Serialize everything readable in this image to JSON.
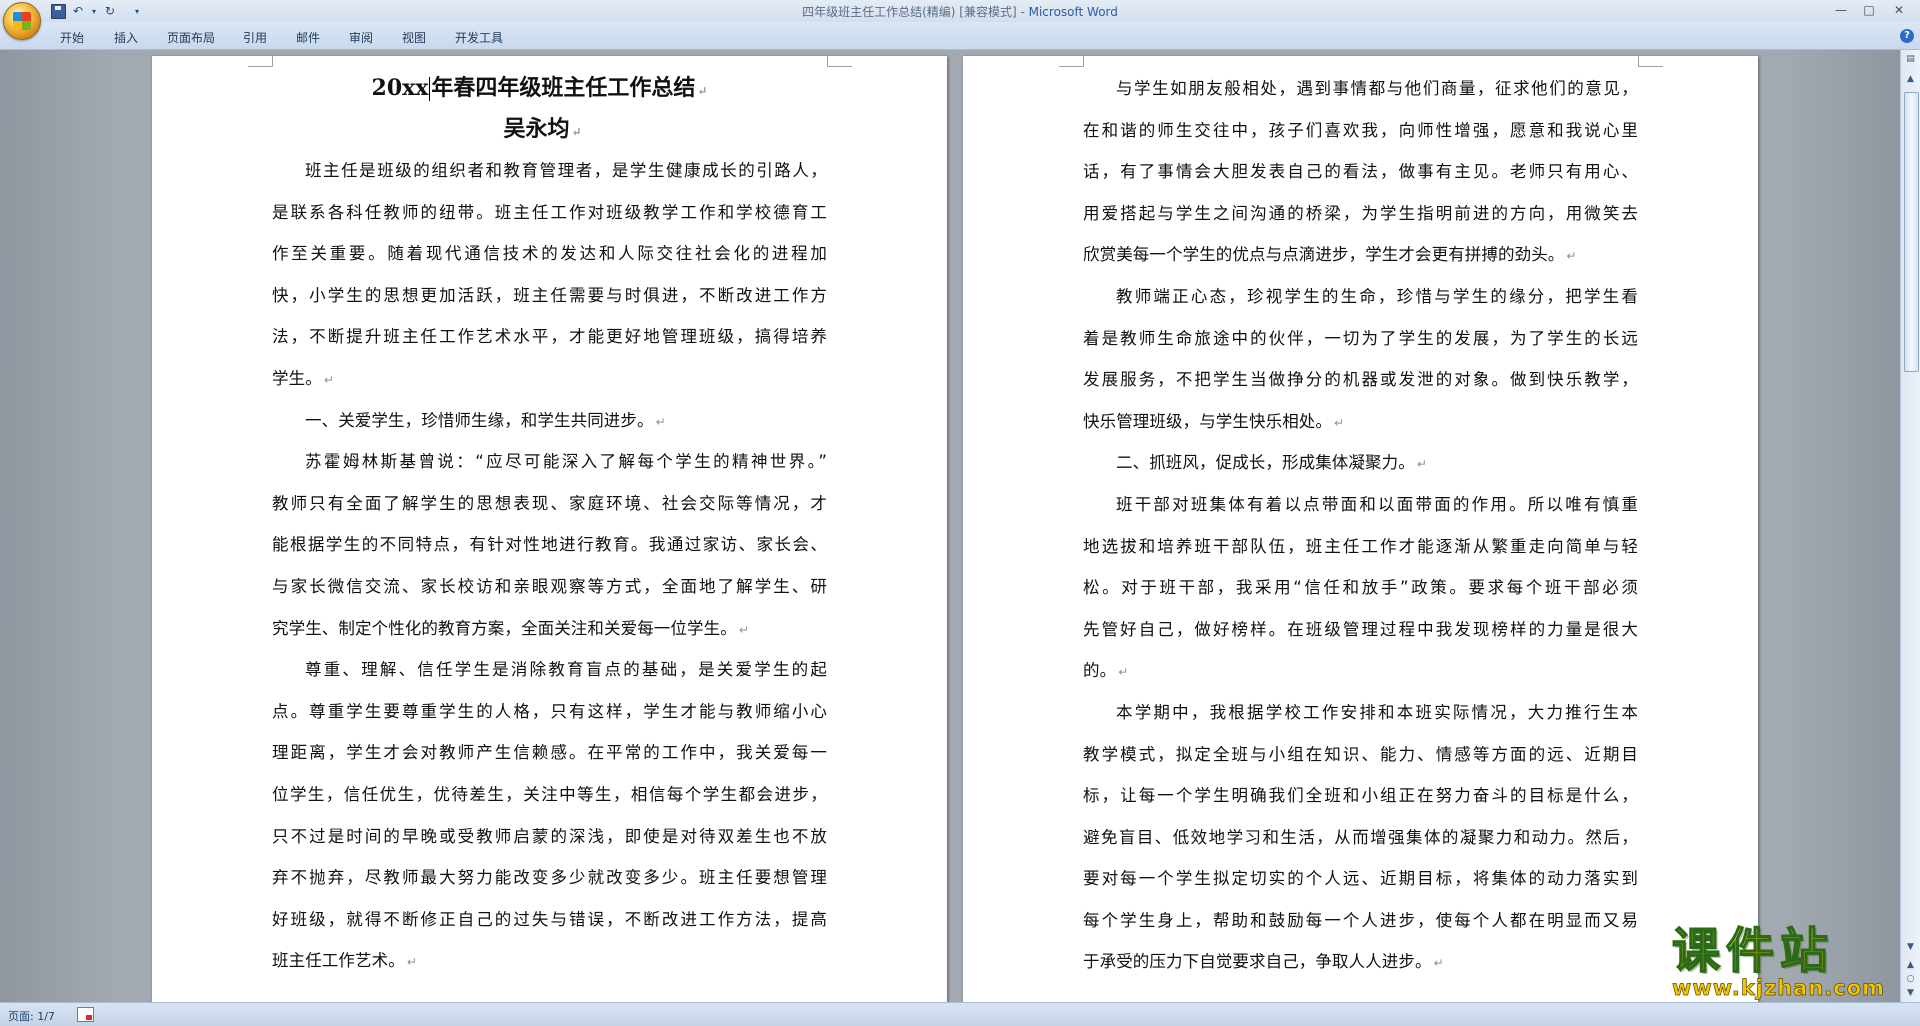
{
  "window": {
    "title": "四年级班主任工作总结(精编) [兼容模式] - ",
    "app_name": "Microsoft Word",
    "controls": [
      "—",
      "□",
      "✕"
    ]
  },
  "qat": {
    "undo": "↶",
    "redo": "↻",
    "customize": "▾"
  },
  "ribbon": {
    "tabs": [
      "开始",
      "插入",
      "页面布局",
      "引用",
      "邮件",
      "审阅",
      "视图",
      "开发工具"
    ],
    "help": "?"
  },
  "document": {
    "title_pre": "20xx",
    "title_post": "年春四年级班主任工作总结",
    "author": "吴永均",
    "paragraph_mark": "↵",
    "left_page_lines": [
      {
        "text": "班主任是班级的组织者和教育管理者，是学生健康成长的引路人，",
        "indent": true,
        "last": false
      },
      {
        "text": "是联系各科任教师的纽带。班主任工作对班级教学工作和学校德育工",
        "indent": false,
        "last": false
      },
      {
        "text": "作至关重要。随着现代通信技术的发达和人际交往社会化的进程加",
        "indent": false,
        "last": false
      },
      {
        "text": "快，小学生的思想更加活跃，班主任需要与时俱进，不断改进工作方",
        "indent": false,
        "last": false
      },
      {
        "text": "法，不断提升班主任工作艺术水平，才能更好地管理班级，搞得培养",
        "indent": false,
        "last": false
      },
      {
        "text": "学生。",
        "indent": false,
        "last": true
      },
      {
        "text": "一、关爱学生，珍惜师生缘，和学生共同进步。",
        "indent": true,
        "last": true
      },
      {
        "text": "苏霍姆林斯基曾说：“应尽可能深入了解每个学生的精神世界。”",
        "indent": true,
        "last": false
      },
      {
        "text": "教师只有全面了解学生的思想表现、家庭环境、社会交际等情况，才",
        "indent": false,
        "last": false
      },
      {
        "text": "能根据学生的不同特点，有针对性地进行教育。我通过家访、家长会、",
        "indent": false,
        "last": false
      },
      {
        "text": "与家长微信交流、家长校访和亲眼观察等方式，全面地了解学生、研",
        "indent": false,
        "last": false
      },
      {
        "text": "究学生、制定个性化的教育方案，全面关注和关爱每一位学生。",
        "indent": false,
        "last": true
      },
      {
        "text": "尊重、理解、信任学生是消除教育盲点的基础，是关爱学生的起",
        "indent": true,
        "last": false
      },
      {
        "text": "点。尊重学生要尊重学生的人格，只有这样，学生才能与教师缩小心",
        "indent": false,
        "last": false
      },
      {
        "text": "理距离，学生才会对教师产生信赖感。在平常的工作中，我关爱每一",
        "indent": false,
        "last": false
      },
      {
        "text": "位学生，信任优生，优待差生，关注中等生，相信每个学生都会进步，",
        "indent": false,
        "last": false
      },
      {
        "text": "只不过是时间的早晚或受教师启蒙的深浅，即使是对待双差生也不放",
        "indent": false,
        "last": false
      },
      {
        "text": "弃不抛弃，尽教师最大努力能改变多少就改变多少。班主任要想管理",
        "indent": false,
        "last": false
      },
      {
        "text": "好班级，就得不断修正自己的过失与错误，不断改进工作方法，提高",
        "indent": false,
        "last": false
      },
      {
        "text": "班主任工作艺术。",
        "indent": false,
        "last": true
      }
    ],
    "right_page_lines": [
      {
        "text": "与学生如朋友般相处，遇到事情都与他们商量，征求他们的意见，",
        "indent": true,
        "last": false
      },
      {
        "text": "在和谐的师生交往中，孩子们喜欢我，向师性增强，愿意和我说心里",
        "indent": false,
        "last": false
      },
      {
        "text": "话，有了事情会大胆发表自己的看法，做事有主见。老师只有用心、",
        "indent": false,
        "last": false
      },
      {
        "text": "用爱搭起与学生之间沟通的桥梁，为学生指明前进的方向，用微笑去",
        "indent": false,
        "last": false
      },
      {
        "text": "欣赏美每一个学生的优点与点滴进步，学生才会更有拼搏的劲头。",
        "indent": false,
        "last": true
      },
      {
        "text": "教师端正心态，珍视学生的生命，珍惜与学生的缘分，把学生看",
        "indent": true,
        "last": false
      },
      {
        "text": "着是教师生命旅途中的伙伴，一切为了学生的发展，为了学生的长远",
        "indent": false,
        "last": false
      },
      {
        "text": "发展服务，不把学生当做挣分的机器或发泄的对象。做到快乐教学，",
        "indent": false,
        "last": false
      },
      {
        "text": "快乐管理班级，与学生快乐相处。",
        "indent": false,
        "last": true
      },
      {
        "text": "二、抓班风，促成长，形成集体凝聚力。",
        "indent": true,
        "last": true
      },
      {
        "text": "班干部对班集体有着以点带面和以面带面的作用。所以唯有慎重",
        "indent": true,
        "last": false
      },
      {
        "text": "地选拔和培养班干部队伍，班主任工作才能逐渐从繁重走向简单与轻",
        "indent": false,
        "last": false
      },
      {
        "text": "松。对于班干部，我采用“信任和放手”政策。要求每个班干部必须",
        "indent": false,
        "last": false
      },
      {
        "text": "先管好自己，做好榜样。在班级管理过程中我发现榜样的力量是很大",
        "indent": false,
        "last": false
      },
      {
        "text": "的。",
        "indent": false,
        "last": true
      },
      {
        "text": "本学期中，我根据学校工作安排和本班实际情况，大力推行生本",
        "indent": true,
        "last": false
      },
      {
        "text": "教学模式，拟定全班与小组在知识、能力、情感等方面的远、近期目",
        "indent": false,
        "last": false
      },
      {
        "text": "标，让每一个学生明确我们全班和小组正在努力奋斗的目标是什么，",
        "indent": false,
        "last": false
      },
      {
        "text": "避免盲目、低效地学习和生活，从而增强集体的凝聚力和动力。然后，",
        "indent": false,
        "last": false
      },
      {
        "text": "要对每一个学生拟定切实的个人远、近期目标，将集体的动力落实到",
        "indent": false,
        "last": false
      },
      {
        "text": "每个学生身上，帮助和鼓励每一个人进步，使每个人都在明显而又易",
        "indent": false,
        "last": false
      },
      {
        "text": "于承受的压力下自觉要求自己，争取人人进步。",
        "indent": false,
        "last": true
      }
    ]
  },
  "status": {
    "page": "页面: 1/7"
  },
  "scrollbar": {
    "up": "▲",
    "down": "▼",
    "prev_page": "▲",
    "select_browse": "○",
    "next_page": "▼"
  },
  "watermark": {
    "title": "课件站",
    "url": "www.kjzhan.com"
  }
}
